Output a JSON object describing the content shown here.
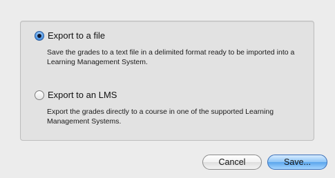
{
  "options": [
    {
      "label": "Export to a file",
      "description": "Save the grades to a text file in a delimited format ready to be imported into a Learning Management System.",
      "selected": true
    },
    {
      "label": "Export to an LMS",
      "description": "Export the grades directly to a course in one of the supported Learning Management Systems.",
      "selected": false
    }
  ],
  "buttons": {
    "cancel_label": "Cancel",
    "save_label": "Save..."
  },
  "colors": {
    "dialog_background": "#ececec",
    "group_background": "#e2e2e2",
    "default_button_accent": "#5aa4ec"
  }
}
